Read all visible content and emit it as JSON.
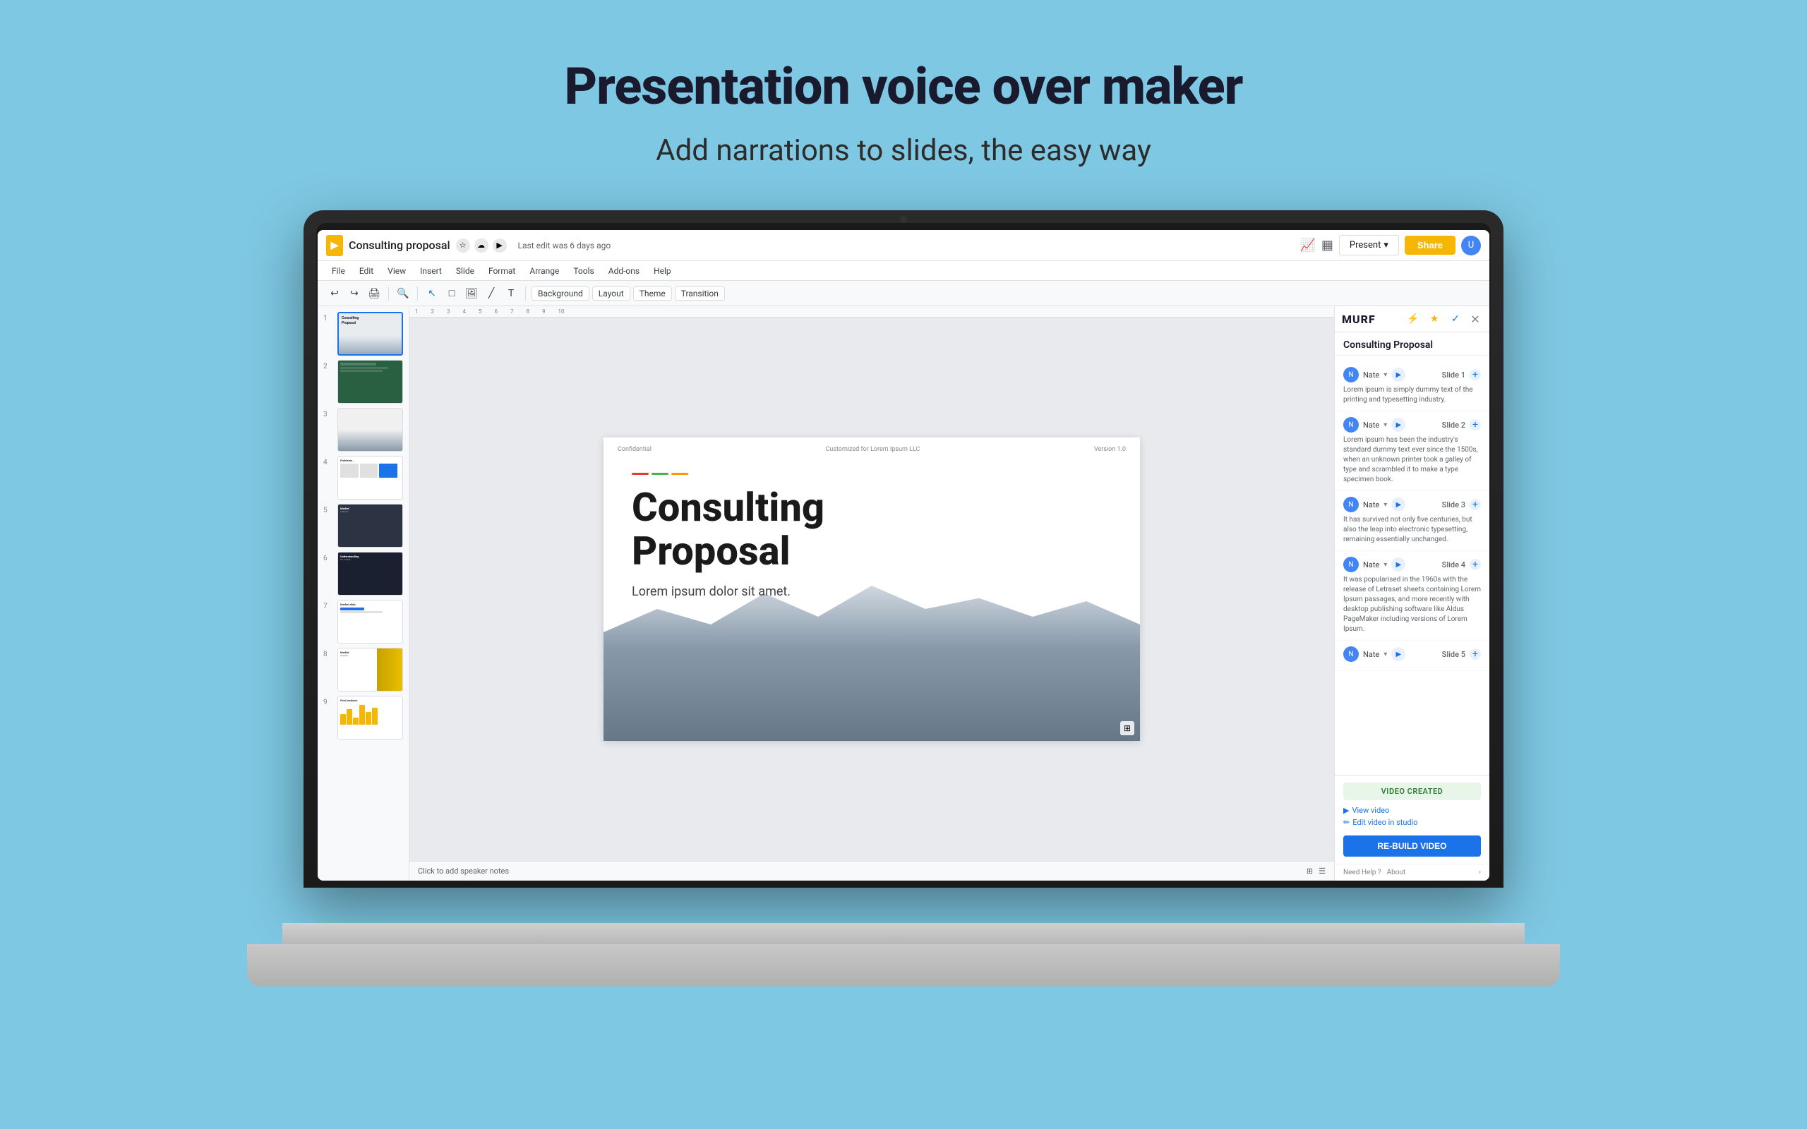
{
  "page": {
    "bg_color": "#7ec8e3",
    "title": "Presentation voice over maker",
    "subtitle": "Add narrations to slides, the easy way"
  },
  "slides_app": {
    "document_title": "Consulting proposal",
    "last_edit": "Last edit was 6 days ago",
    "menu_items": [
      "File",
      "Edit",
      "View",
      "Insert",
      "Slide",
      "Format",
      "Arrange",
      "Tools",
      "Add-ons",
      "Help"
    ],
    "toolbar_items": [
      "Background",
      "Layout",
      "Theme",
      "Transition"
    ],
    "btn_present": "Present",
    "btn_share": "Share",
    "slide_count": 9,
    "active_slide": 1,
    "canvas": {
      "confidential_label": "Confidential",
      "customized_for": "Customized for Lorem Ipsum LLC",
      "version": "Version 1.0",
      "title_line1": "Consulting",
      "title_line2": "Proposal",
      "subtitle": "Lorem ipsum dolor sit amet.",
      "bottom_text": "Click to add speaker notes",
      "accent_colors": [
        "#e53935",
        "#4caf50",
        "#ff9800"
      ]
    }
  },
  "murf_panel": {
    "title": "MURF",
    "project_title": "Consulting Proposal",
    "slides": [
      {
        "label": "Slide 1",
        "voice_name": "Nate",
        "text": "Lorem ipsum is simply dummy text of the printing and typesetting industry."
      },
      {
        "label": "Slide 2",
        "voice_name": "Nate",
        "text": "Lorem ipsum has been the industry's standard dummy text ever since the 1500s, when an unknown printer took a galley of type and scrambled it to make a type specimen book."
      },
      {
        "label": "Slide 3",
        "voice_name": "Nate",
        "text": "It has survived not only five centuries, but also the leap into electronic typesetting, remaining essentially unchanged."
      },
      {
        "label": "Slide 4",
        "voice_name": "Nate",
        "text": "It was popularised in the 1960s with the release of Letraset sheets containing Lorem Ipsum passages, and more recently with desktop publishing software like Aldus PageMaker including versions of Lorem Ipsum."
      },
      {
        "label": "Slide 5",
        "voice_name": "Nate",
        "text": ""
      }
    ],
    "video_created_label": "VIDEO CREATED",
    "view_video_link": "View video",
    "edit_video_link": "Edit video in studio",
    "rebuild_btn": "RE-BUILD VIDEO",
    "footer": {
      "help": "Need Help ?",
      "about": "About"
    }
  }
}
